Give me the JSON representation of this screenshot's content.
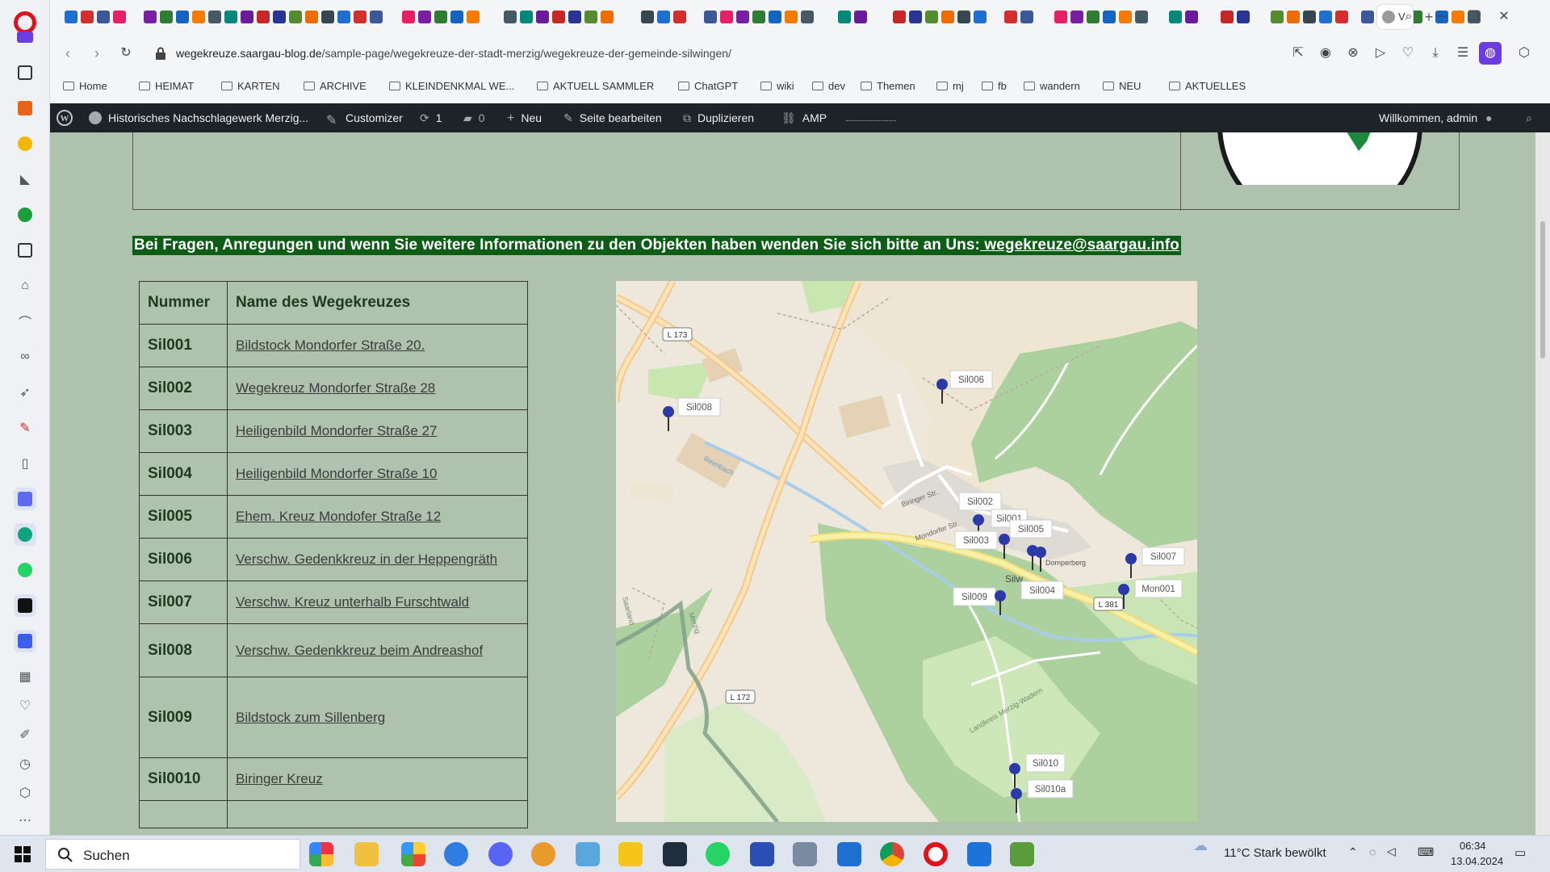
{
  "browser": {
    "active_tab_title": "V",
    "url_host": "wegekreuze.saargau-blog.de",
    "url_path": "/sample-page/wegekreuze-der-stadt-merzig/wegekreuze-der-gemeinde-silwingen/",
    "new_tab_label": "+"
  },
  "bookmarks": [
    "Home",
    "HEIMAT",
    "KARTEN",
    "ARCHIVE",
    "KLEINDENKMAL WE...",
    "AKTUELL SAMMLER",
    "ChatGPT",
    "wiki",
    "dev",
    "Themen",
    "mj",
    "fb",
    "wandern",
    "NEU",
    "AKTUELLES"
  ],
  "adminbar": {
    "site_name": "Historisches Nachschlagewerk Merzig...",
    "customizer": "Customizer",
    "updates_count": "1",
    "comments_count": "0",
    "new": "Neu",
    "edit_page": "Seite bearbeiten",
    "duplicate": "Duplizieren",
    "amp": "AMP",
    "welcome": "Willkommen, admin"
  },
  "page": {
    "info_text": "Bei Fragen, Anregungen und wenn Sie weitere Informationen zu den Objekten haben wenden Sie sich bitte an Uns:",
    "info_email": " wegekreuze@saargau.info",
    "table": {
      "headers": [
        "Nummer",
        "Name des Wegekreuzes"
      ],
      "rows": [
        {
          "num": "Sil001",
          "name": "Bildstock Mondorfer Straße 20."
        },
        {
          "num": "Sil002",
          "name": "Wegekreuz Mondorfer Straße 28"
        },
        {
          "num": "Sil003",
          "name": "Heiligenbild Mondorfer Straße 27"
        },
        {
          "num": "Sil004",
          "name": "Heiligenbild Mondorfer Straße 10"
        },
        {
          "num": "Sil005",
          "name": "Ehem. Kreuz Mondofer Straße 12"
        },
        {
          "num": "Sil006",
          "name": "Verschw. Gedenkkreuz in der Heppengräth"
        },
        {
          "num": "Sil007",
          "name": "Verschw. Kreuz unterhalb Furschtwald"
        },
        {
          "num": "Sil008",
          "name": "Verschw. Gedenkkreuz beim Andreashof"
        },
        {
          "num": "Sil009",
          "name": "Bildstock zum Sillenberg"
        },
        {
          "num": "Sil0010",
          "name": "Biringer Kreuz"
        },
        {
          "num": "",
          "name": ""
        }
      ]
    },
    "map": {
      "road_labels": [
        "L 173",
        "L 172",
        "L 381"
      ],
      "street_labels": [
        "Biringer Str.",
        "Mondorfer Str.",
        "Domperberg",
        "Reimbach",
        "Landkreis Merzig-Wadern",
        "Saarland",
        "Merzig",
        "Silw..."
      ],
      "markers": [
        "Sil006",
        "Sil008",
        "Sil002",
        "Sil001",
        "Sil003",
        "Sil005",
        "Sil007",
        "Sil004",
        "Mon001",
        "Sil009",
        "Sil010",
        "Sil010a"
      ]
    }
  },
  "taskbar": {
    "search_label": "Suchen",
    "weather": "11°C  Stark bewölkt",
    "time": "06:34",
    "date": "13.04.2024"
  },
  "colors": {
    "page_bg": "#afc2ad",
    "info_bg": "#0d5d17",
    "admin_bar": "#1d2327",
    "opera_red": "#e0121c",
    "marker_blue": "#2c3aa8"
  }
}
